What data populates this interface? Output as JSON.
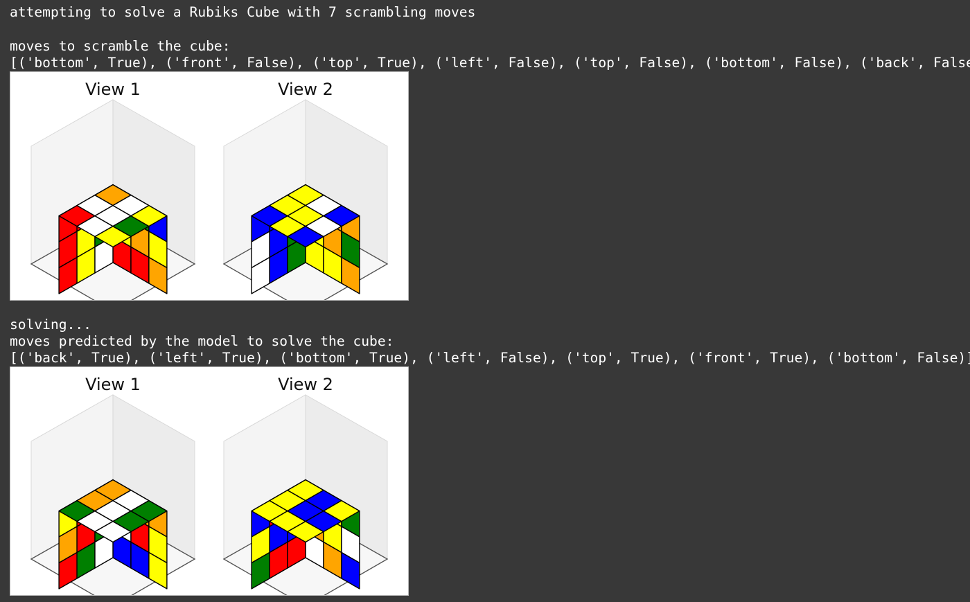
{
  "output": {
    "heading": "attempting to solve a Rubiks Cube with 7 scrambling moves",
    "scramble_label": "moves to scramble the cube:",
    "scramble_moves": "[('bottom', True), ('front', False), ('top', True), ('left', False), ('top', False), ('bottom', False), ('back', False)]",
    "solving_label": "solving...",
    "predicted_label": "moves predicted by the model to solve the cube:",
    "predicted_moves": "[('back', True), ('left', True), ('bottom', True), ('left', False), ('top', True), ('front', True), ('bottom', False)]"
  },
  "plots": [
    {
      "name": "scrambled-cube-plot",
      "view_titles": [
        "View 1",
        "View 2"
      ],
      "views": [
        {
          "top": [
            "R",
            "W",
            "Y",
            "W",
            "W",
            "G",
            "O",
            "W",
            "Y"
          ],
          "left": [
            "R",
            "R",
            "G",
            "R",
            "Y",
            "G",
            "R",
            "Y",
            "W"
          ],
          "right": [
            "Y",
            "G",
            "B",
            "Y",
            "O",
            "Y",
            "R",
            "R",
            "O"
          ]
        },
        {
          "top": [
            "B",
            "Y",
            "B",
            "Y",
            "Y",
            "W",
            "Y",
            "W",
            "B"
          ],
          "left": [
            "B",
            "B",
            "G",
            "W",
            "B",
            "G",
            "W",
            "B",
            "G"
          ],
          "right": [
            "O",
            "O",
            "O",
            "Y",
            "O",
            "G",
            "Y",
            "Y",
            "O"
          ]
        }
      ]
    },
    {
      "name": "predicted-solve-plot",
      "view_titles": [
        "View 1",
        "View 2"
      ],
      "views": [
        {
          "top": [
            "G",
            "W",
            "W",
            "O",
            "W",
            "G",
            "O",
            "W",
            "G"
          ],
          "left": [
            "Y",
            "R",
            "B",
            "O",
            "R",
            "G",
            "R",
            "G",
            "W"
          ],
          "right": [
            "R",
            "O",
            "O",
            "W",
            "R",
            "Y",
            "B",
            "B",
            "Y"
          ]
        },
        {
          "top": [
            "Y",
            "Y",
            "Y",
            "Y",
            "B",
            "B",
            "Y",
            "B",
            "Y"
          ],
          "left": [
            "B",
            "R",
            "O",
            "Y",
            "B",
            "B",
            "G",
            "R",
            "R"
          ],
          "right": [
            "Y",
            "Y",
            "G",
            "O",
            "Y",
            "W",
            "W",
            "O",
            "B"
          ]
        }
      ]
    }
  ],
  "colors": {
    "R": "#ff0000",
    "G": "#007f00",
    "B": "#0000ff",
    "Y": "#ffff00",
    "O": "#ffa500",
    "W": "#ffffff",
    "background": "#383838",
    "text": "#ffffff",
    "panel": "#f4f4f4"
  }
}
